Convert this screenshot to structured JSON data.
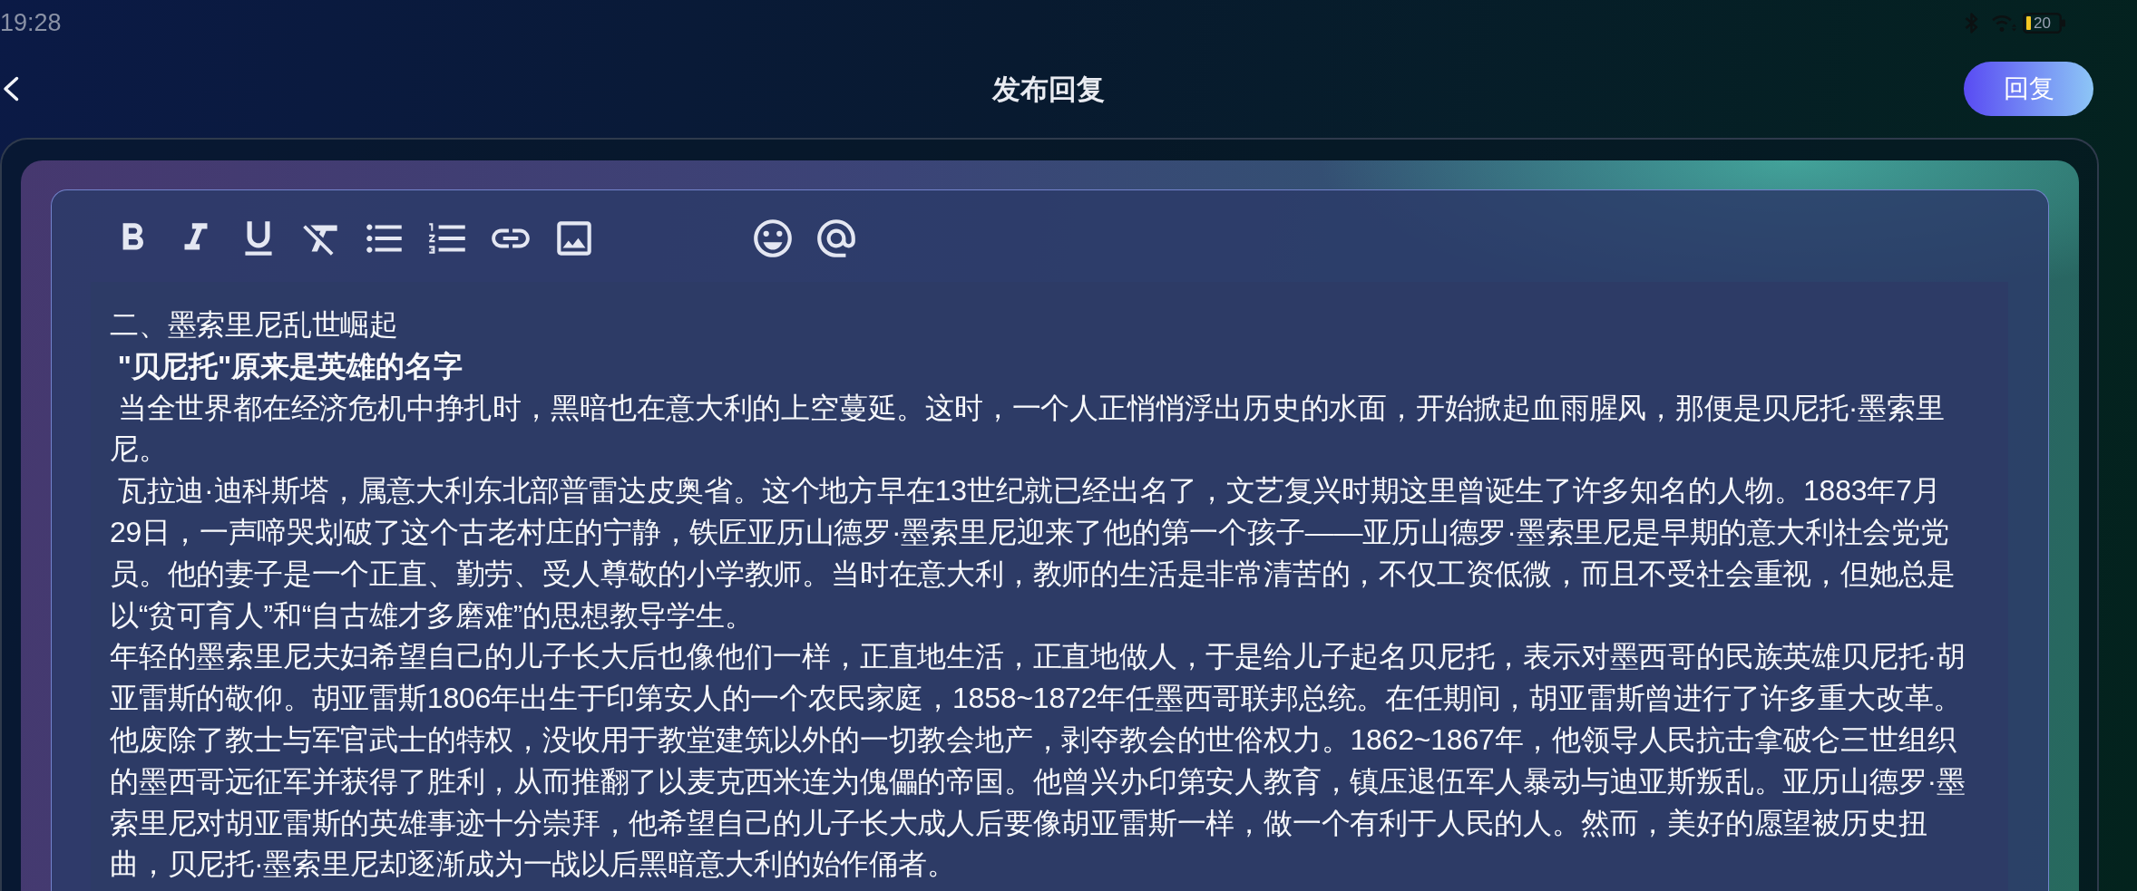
{
  "status_bar": {
    "time": "19:28",
    "battery": "20"
  },
  "header": {
    "title": "发布回复",
    "reply_button": "回复"
  },
  "toolbar": {
    "format_tools": [
      {
        "kind": "bold"
      },
      {
        "kind": "italic"
      },
      {
        "kind": "underline"
      },
      {
        "kind": "clear_format"
      },
      {
        "kind": "bulleted_list"
      },
      {
        "kind": "numbered_list"
      },
      {
        "kind": "link"
      },
      {
        "kind": "image"
      }
    ],
    "insert_tools": [
      {
        "kind": "emoji"
      },
      {
        "kind": "mention"
      }
    ]
  },
  "editor": {
    "paragraphs": [
      {
        "text": "二、墨索里尼乱世崛起",
        "bold": false
      },
      {
        "text": " \"贝尼托\"原来是英雄的名字",
        "bold": true
      },
      {
        "text": " 当全世界都在经济危机中挣扎时，黑暗也在意大利的上空蔓延。这时，一个人正悄悄浮出历史的水面，开始掀起血雨腥风，那便是贝尼托·墨索里尼。",
        "bold": false
      },
      {
        "text": " 瓦拉迪·迪科斯塔，属意大利东北部普雷达皮奥省。这个地方早在13世纪就已经出名了，文艺复兴时期这里曾诞生了许多知名的人物。1883年7月29日，一声啼哭划破了这个古老村庄的宁静，铁匠亚历山德罗·墨索里尼迎来了他的第一个孩子——亚历山德罗·墨索里尼是早期的意大利社会党党员。他的妻子是一个正直、勤劳、受人尊敬的小学教师。当时在意大利，教师的生活是非常清苦的，不仅工资低微，而且不受社会重视，但她总是以“贫可育人”和“自古雄才多磨难”的思想教导学生。",
        "bold": false
      },
      {
        "text": "年轻的墨索里尼夫妇希望自己的儿子长大后也像他们一样，正直地生活，正直地做人，于是给儿子起名贝尼托，表示对墨西哥的民族英雄贝尼托·胡亚雷斯的敬仰。胡亚雷斯1806年出生于印第安人的一个农民家庭，1858~1872年任墨西哥联邦总统。在任期间，胡亚雷斯曾进行了许多重大改革。他废除了教士与军官武士的特权，没收用于教堂建筑以外的一切教会地产，剥夺教会的世俗权力。1862~1867年，他领导人民抗击拿破仑三世组织的墨西哥远征军并获得了胜利，从而推翻了以麦克西米连为傀儡的帝国。他曾兴办印第安人教育，镇压退伍军人暴动与迪亚斯叛乱。亚历山德罗·墨索里尼对胡亚雷斯的英雄事迹十分崇拜，他希望自己的儿子长大成人后要像胡亚雷斯一样，做一个有利于人民的人。然而，美好的愿望被历史扭曲，贝尼托·墨索里尼却逐渐成为一战以后黑暗意大利的始作俑者。",
        "bold": false
      }
    ]
  }
}
